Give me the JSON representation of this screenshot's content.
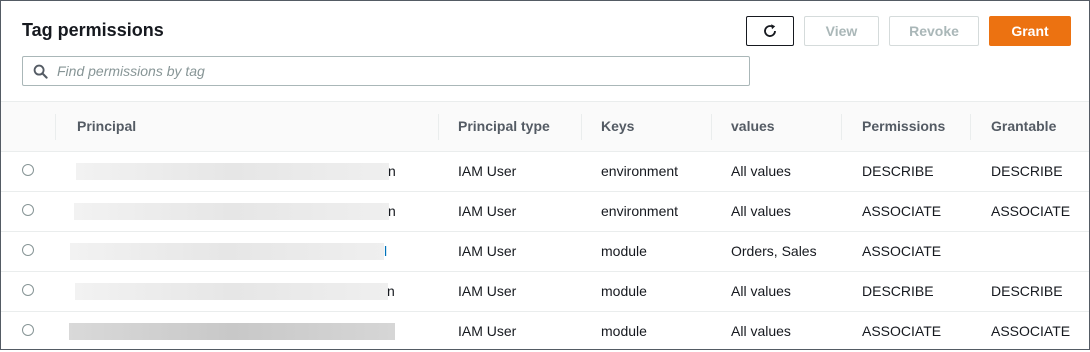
{
  "panel": {
    "title": "Tag permissions",
    "buttons": {
      "refresh_icon": "refresh-icon",
      "view": "View",
      "revoke": "Revoke",
      "grant": "Grant"
    },
    "search": {
      "placeholder": "Find permissions by tag",
      "value": ""
    }
  },
  "table": {
    "columns": [
      "Principal",
      "Principal type",
      "Keys",
      "values",
      "Permissions",
      "Grantable"
    ],
    "rows": [
      {
        "principal_tail": "n",
        "principal_type": "IAM User",
        "keys": "environment",
        "values": "All values",
        "permissions": "DESCRIBE",
        "grantable": "DESCRIBE"
      },
      {
        "principal_tail": "n",
        "principal_type": "IAM User",
        "keys": "environment",
        "values": "All values",
        "permissions": "ASSOCIATE",
        "grantable": "ASSOCIATE"
      },
      {
        "principal_tail": "l",
        "principal_type": "IAM User",
        "keys": "module",
        "values": "Orders, Sales",
        "permissions": "ASSOCIATE",
        "grantable": ""
      },
      {
        "principal_tail": "n",
        "principal_type": "IAM User",
        "keys": "module",
        "values": "All values",
        "permissions": "DESCRIBE",
        "grantable": "DESCRIBE"
      },
      {
        "principal_tail": "",
        "principal_type": "IAM User",
        "keys": "module",
        "values": "All values",
        "permissions": "ASSOCIATE",
        "grantable": "ASSOCIATE"
      }
    ]
  },
  "colors": {
    "accent": "#ec7211",
    "border": "#545b64",
    "disabled_text": "#aab7b8"
  }
}
